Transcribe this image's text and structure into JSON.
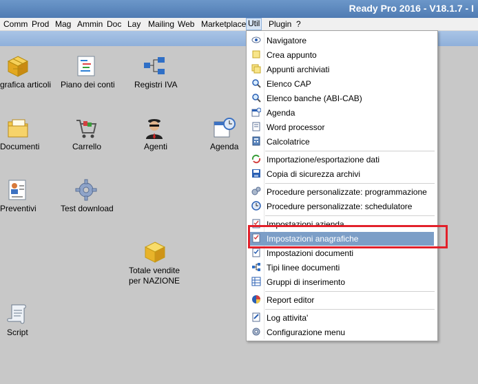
{
  "window": {
    "title": "Ready Pro 2016 - V18.1.7 - I"
  },
  "menubar": [
    {
      "label": "Comm",
      "active": false
    },
    {
      "label": "Prod",
      "active": false
    },
    {
      "label": "Mag",
      "active": false
    },
    {
      "label": "Ammin",
      "active": false
    },
    {
      "label": "Doc",
      "active": false
    },
    {
      "label": "Lay",
      "active": false
    },
    {
      "label": "Mailing",
      "active": false
    },
    {
      "label": "Web",
      "active": false
    },
    {
      "label": "Marketplace",
      "active": false
    },
    {
      "label": "Util",
      "active": true
    },
    {
      "label": "Plugin",
      "active": false
    },
    {
      "label": "?",
      "active": false
    }
  ],
  "desktop": [
    {
      "label": "grafica articoli",
      "icon": "cube-icon"
    },
    {
      "label": "Piano dei conti",
      "icon": "list-icon"
    },
    {
      "label": "Registri IVA",
      "icon": "network-icon"
    },
    {
      "label": "Documenti",
      "icon": "folder-icon"
    },
    {
      "label": "Carrello",
      "icon": "cart-icon"
    },
    {
      "label": "Agenti",
      "icon": "agent-icon"
    },
    {
      "label": "Agenda",
      "icon": "calendar-clock-icon"
    },
    {
      "label": "Preventivi",
      "icon": "document-person-icon"
    },
    {
      "label": "Test download",
      "icon": "gear-icon"
    },
    {
      "label": "Totale vendite per NAZIONE",
      "icon": "cube-icon"
    },
    {
      "label": "Script",
      "icon": "scroll-icon"
    }
  ],
  "util_menu": [
    {
      "label": "Navigatore",
      "icon": "eye-icon"
    },
    {
      "label": "Crea appunto",
      "icon": "note-icon"
    },
    {
      "label": "Appunti archiviati",
      "icon": "notes-icon"
    },
    {
      "label": "Elenco CAP",
      "icon": "magnifier-icon"
    },
    {
      "label": "Elenco banche (ABI-CAB)",
      "icon": "magnifier-icon"
    },
    {
      "label": "Agenda",
      "icon": "calendar-icon"
    },
    {
      "label": "Word processor",
      "icon": "page-icon"
    },
    {
      "label": "Calcolatrice",
      "icon": "calculator-icon"
    },
    {
      "label": "Importazione/esportazione dati",
      "icon": "arrows-icon"
    },
    {
      "label": "Copia di sicurezza archivi",
      "icon": "disk-icon"
    },
    {
      "label": "Procedure personalizzate: programmazione",
      "icon": "gears-icon"
    },
    {
      "label": "Procedure personalizzate: schedulatore",
      "icon": "clock-icon"
    },
    {
      "label": "Impostazioni azienda",
      "icon": "checklist-icon"
    },
    {
      "label": "Impostazioni anagrafiche",
      "icon": "checklist-icon",
      "highlighted": true
    },
    {
      "label": "Impostazioni documenti",
      "icon": "checklist-icon"
    },
    {
      "label": "Tipi linee documenti",
      "icon": "network-icon"
    },
    {
      "label": "Gruppi di inserimento",
      "icon": "grid-icon"
    },
    {
      "label": "Report editor",
      "icon": "report-icon"
    },
    {
      "label": "Log attivita'",
      "icon": "log-icon"
    },
    {
      "label": "Configurazione menu",
      "icon": "gear-icon"
    }
  ],
  "colors": {
    "highlight": "#7c9ec7",
    "annotation": "#e2202a",
    "titlebar": "#5b86bd"
  }
}
